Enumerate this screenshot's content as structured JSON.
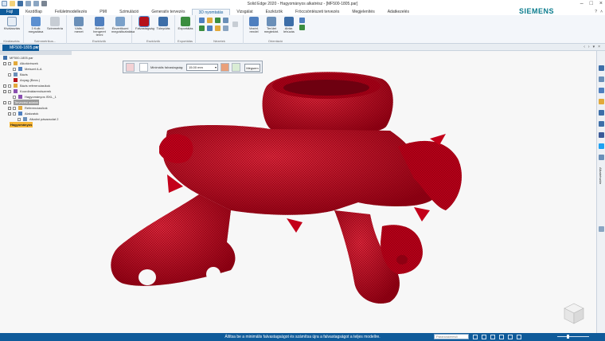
{
  "app": {
    "title": "Solid Edge 2020 - Hagyományos alkatrész - [MF500-1805.par]",
    "brand": "SIEMENS",
    "accent": "#0f5b9a"
  },
  "ribbon_tabs": [
    "Fájl",
    "Kezdőlap",
    "Felületmodellezés",
    "PMI",
    "Szimuláció",
    "Generatív tervezés",
    "3D nyomtatás",
    "Vizsgálat",
    "Eszközök",
    "Fröccsöntészeti tervezés",
    "Megjelenítés",
    "Adatkezelés"
  ],
  "active_tab": "3D nyomtatás",
  "ribbon": {
    "groups": [
      {
        "label": "Kiválasztás",
        "buttons": [
          "Kiválasztás"
        ]
      },
      {
        "label": "Szimmetrikus...",
        "buttons": [
          "3 Kulk megadása",
          "Szimmetria"
        ]
      },
      {
        "label": "Eszközök",
        "buttons": [
          "Válts. menet",
          "Bélelő hengeret tenni",
          "Ékvertikumi megváltoztatása"
        ]
      },
      {
        "label": "Eszközök",
        "buttons": [
          "Falvastagság",
          "Túlnyúlás"
        ]
      },
      {
        "label": "Exportálás",
        "buttons": [
          "Exportálás"
        ]
      },
      {
        "label": "Nézetek",
        "buttons": []
      },
      {
        "label": "Orientáció",
        "buttons": [
          "Vezérl. rendel",
          "Terület megtekint.",
          "Abtár. lehúzás"
        ]
      }
    ],
    "help_label": "?"
  },
  "doc_tab": {
    "label": "MF500-1805.par",
    "close": "×"
  },
  "pathfinder": {
    "rows": [
      {
        "label": "MF500-1805.par",
        "level": 0
      },
      {
        "label": "Alkotórészek",
        "level": 1
      },
      {
        "label": "Metszet A-A",
        "level": 2
      },
      {
        "label": "Bázis",
        "level": 1
      },
      {
        "label": "Anyag (Becs.)",
        "level": 1
      },
      {
        "label": "Bázis referenciasíkok",
        "level": 1
      },
      {
        "label": "Koordinátarendszerek",
        "level": 1
      },
      {
        "label": "Hagyományos ISKL_1",
        "level": 2
      },
      {
        "label": "Tervezési adatok",
        "level": 0
      },
      {
        "label": "Referenciasíkok",
        "level": 1
      },
      {
        "label": "Alakzatok",
        "level": 1
      },
      {
        "label": "Alkalmi pásacsolat 2",
        "level": 2
      },
      {
        "label": "Hagyományos",
        "level": 0
      }
    ]
  },
  "command_bar": {
    "label": "Minimális falvastagság:",
    "value": "15.00 mm",
    "ok_label": "Mégsem"
  },
  "right_panel": {
    "vertical_label": "Alkatrésztár"
  },
  "statusbar": {
    "message": "Állítsa be a minimális falvastagságot és számítsa újra a falvastagságot a teljes modellre.",
    "command_finder_placeholder": "Parancskereső"
  },
  "model_color": "#c4001a"
}
